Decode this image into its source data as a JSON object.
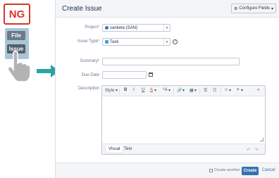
{
  "left_panel": {
    "badge": "NG",
    "file_label": "File",
    "issue_label": "Issue"
  },
  "dialog": {
    "title": "Create Issue",
    "configure_fields_label": "Configure Fields",
    "project": {
      "label": "Project",
      "value": "sanketa (SAN)"
    },
    "issue_type": {
      "label": "Issue Type",
      "value": "Task"
    },
    "summary": {
      "label": "Summary",
      "value": ""
    },
    "due_date": {
      "label": "Due Date",
      "value": ""
    },
    "description": {
      "label": "Description",
      "value": ""
    },
    "toolbar": {
      "style_label": "Style",
      "bold": "B",
      "italic": "I",
      "underline": "U",
      "text_color": "A",
      "text_size": "ᴬA",
      "link": "🔗",
      "table": "▦",
      "bullet_list": "☰",
      "numbered_list": "☷",
      "emoticon": "☺",
      "more": "+",
      "collapse": "«"
    },
    "editor_tabs": [
      "Visual",
      "Text"
    ],
    "footer": {
      "create_another_label": "Create another",
      "create_another_checked": false,
      "create_label": "Create",
      "cancel_label": "Cancel"
    }
  },
  "colors": {
    "accent": "#3572b0",
    "arrow": "#2aa3a3",
    "badge_red": "#d9342b"
  }
}
